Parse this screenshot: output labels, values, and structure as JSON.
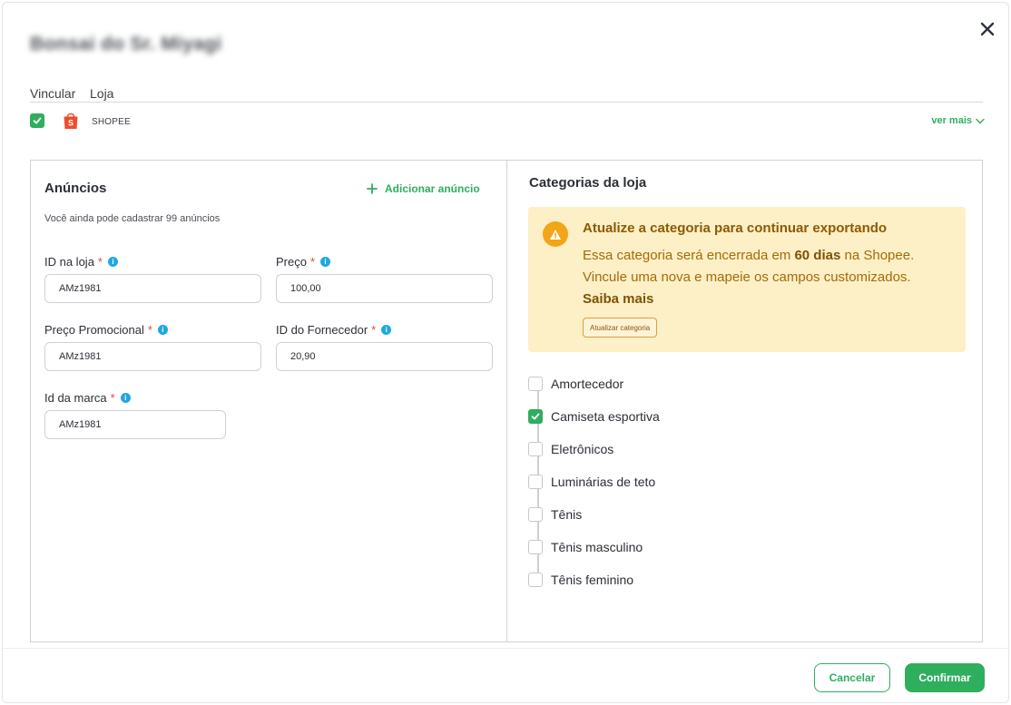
{
  "modal": {
    "title": "Bonsai do Sr. Miyagi"
  },
  "link_table": {
    "col_link": "Vincular",
    "col_store": "Loja",
    "store": {
      "name": "SHOPEE",
      "linked": true,
      "logo_icon": "shopee-bag-icon"
    },
    "see_more": "ver mais"
  },
  "ads": {
    "title": "Anúncios",
    "add_label": "Adicionar anúncio",
    "hint": "Você ainda pode cadastrar 99 anúncios",
    "fields": {
      "store_id": {
        "label": "ID na loja",
        "value": "AMz1981"
      },
      "price": {
        "label": "Preço",
        "value": "100,00"
      },
      "promo_price": {
        "label": "Preço Promocional",
        "value": "AMz1981"
      },
      "supplier_id": {
        "label": "ID do Fornecedor",
        "value": "20,90"
      },
      "brand_id": {
        "label": "Id da marca",
        "value": "AMz1981"
      }
    },
    "required_mark": "*",
    "info_glyph": "i"
  },
  "categories": {
    "title": "Categorias da loja",
    "alert": {
      "title": "Atualize a categoria para continuar exportando",
      "text_before": "Essa categoria será encerrada em ",
      "text_bold": "60 dias",
      "text_after": " na Shopee. Vincule uma nova e mapeie os campos customizados.",
      "link": "Saiba mais",
      "button": "Atualizar categoria"
    },
    "items": [
      {
        "label": "Amortecedor",
        "checked": false
      },
      {
        "label": "Camiseta esportiva",
        "checked": true
      },
      {
        "label": "Eletrônicos",
        "checked": false
      },
      {
        "label": "Luminárias de teto",
        "checked": false
      },
      {
        "label": "Tênis",
        "checked": false
      },
      {
        "label": "Tênis masculino",
        "checked": false
      },
      {
        "label": "Tênis feminino",
        "checked": false
      }
    ]
  },
  "footer": {
    "cancel": "Cancelar",
    "confirm": "Confirmar"
  },
  "colors": {
    "accent": "#2fae5d",
    "alert_bg": "#fdefc6",
    "alert_icon": "#f2a516",
    "info": "#1ea7e4",
    "required": "#e2474b",
    "shopee": "#ee4d2d"
  }
}
